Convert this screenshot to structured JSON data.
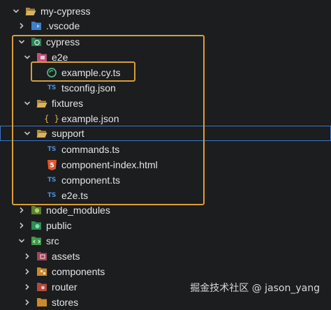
{
  "explorer": {
    "root": "my-cypress",
    "vscode": ".vscode",
    "cypress": "cypress",
    "e2e": "e2e",
    "example_cy": "example.cy.ts",
    "tsconfig": "tsconfig.json",
    "fixtures": "fixtures",
    "example_json": "example.json",
    "support": "support",
    "commands": "commands.ts",
    "component_index": "component-index.html",
    "component": "component.ts",
    "e2e_ts": "e2e.ts",
    "node_modules": "node_modules",
    "public": "public",
    "src": "src",
    "assets": "assets",
    "components": "components",
    "router": "router",
    "stores": "stores"
  },
  "file_badges": {
    "ts": "TS",
    "json": "{ }",
    "html": "5"
  },
  "watermark": "掘金技术社区 @ jason_yang",
  "colors": {
    "background": "#1c1d1f",
    "highlight_box": "#d99d3c",
    "focus_border": "#3b75c7",
    "folder": "#d9b25e",
    "ts": "#4b8fd6",
    "html": "#e2572e",
    "cypress": "#4fb37c",
    "node": "#7cb342"
  }
}
